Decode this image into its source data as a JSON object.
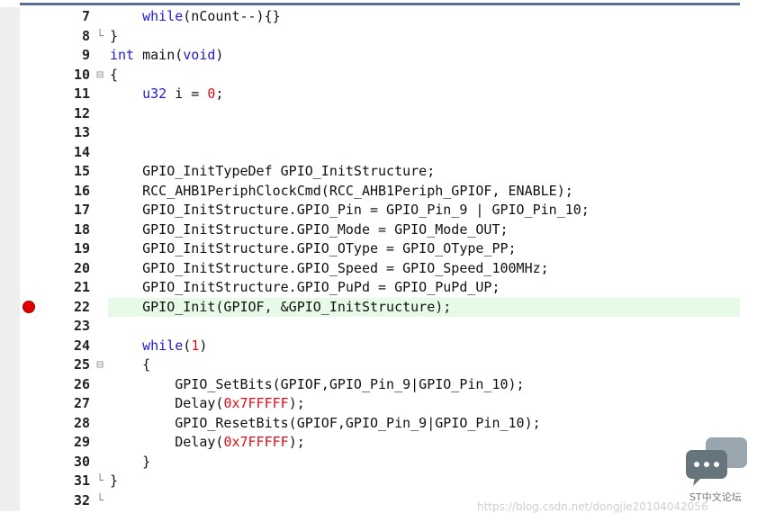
{
  "lines": [
    {
      "num": "7",
      "fold": "",
      "segments": [
        {
          "t": "    "
        },
        {
          "t": "while",
          "c": "kw"
        },
        {
          "t": "(nCount--){}"
        }
      ]
    },
    {
      "num": "8",
      "fold": "└",
      "segments": [
        {
          "t": "}"
        }
      ]
    },
    {
      "num": "9",
      "fold": "",
      "segments": [
        {
          "t": "int",
          "c": "kw"
        },
        {
          "t": " main("
        },
        {
          "t": "void",
          "c": "kw"
        },
        {
          "t": ")"
        }
      ]
    },
    {
      "num": "10",
      "fold": "⊟",
      "segments": [
        {
          "t": "{"
        }
      ]
    },
    {
      "num": "11",
      "fold": "",
      "segments": [
        {
          "t": "    "
        },
        {
          "t": "u32",
          "c": "kw"
        },
        {
          "t": " i = "
        },
        {
          "t": "0",
          "c": "num"
        },
        {
          "t": ";"
        }
      ]
    },
    {
      "num": "12",
      "fold": "",
      "segments": []
    },
    {
      "num": "13",
      "fold": "",
      "segments": []
    },
    {
      "num": "14",
      "fold": "",
      "segments": []
    },
    {
      "num": "15",
      "fold": "",
      "segments": [
        {
          "t": "    GPIO_InitTypeDef GPIO_InitStructure;"
        }
      ]
    },
    {
      "num": "16",
      "fold": "",
      "segments": [
        {
          "t": "    RCC_AHB1PeriphClockCmd(RCC_AHB1Periph_GPIOF, ENABLE);"
        }
      ]
    },
    {
      "num": "17",
      "fold": "",
      "segments": [
        {
          "t": "    GPIO_InitStructure.GPIO_Pin = GPIO_Pin_9 | GPIO_Pin_10;"
        }
      ]
    },
    {
      "num": "18",
      "fold": "",
      "segments": [
        {
          "t": "    GPIO_InitStructure.GPIO_Mode = GPIO_Mode_OUT;"
        }
      ]
    },
    {
      "num": "19",
      "fold": "",
      "segments": [
        {
          "t": "    GPIO_InitStructure.GPIO_OType = GPIO_OType_PP;"
        }
      ]
    },
    {
      "num": "20",
      "fold": "",
      "segments": [
        {
          "t": "    GPIO_InitStructure.GPIO_Speed = GPIO_Speed_100MHz;"
        }
      ]
    },
    {
      "num": "21",
      "fold": "",
      "segments": [
        {
          "t": "    GPIO_InitStructure.GPIO_PuPd = GPIO_PuPd_UP;"
        }
      ]
    },
    {
      "num": "22",
      "fold": "",
      "breakpoint": true,
      "highlight": true,
      "segments": [
        {
          "t": "    GPIO_Init(GPIOF, &GPIO_InitStructure);"
        }
      ]
    },
    {
      "num": "23",
      "fold": "",
      "segments": []
    },
    {
      "num": "24",
      "fold": "",
      "segments": [
        {
          "t": "    "
        },
        {
          "t": "while",
          "c": "kw"
        },
        {
          "t": "("
        },
        {
          "t": "1",
          "c": "num"
        },
        {
          "t": ")"
        }
      ]
    },
    {
      "num": "25",
      "fold": "⊟",
      "segments": [
        {
          "t": "    {"
        }
      ]
    },
    {
      "num": "26",
      "fold": "",
      "segments": [
        {
          "t": "        GPIO_SetBits(GPIOF,GPIO_Pin_9|GPIO_Pin_10);"
        }
      ]
    },
    {
      "num": "27",
      "fold": "",
      "segments": [
        {
          "t": "        Delay("
        },
        {
          "t": "0x7FFFFF",
          "c": "num"
        },
        {
          "t": ");"
        }
      ]
    },
    {
      "num": "28",
      "fold": "",
      "segments": [
        {
          "t": "        GPIO_ResetBits(GPIOF,GPIO_Pin_9|GPIO_Pin_10);"
        }
      ]
    },
    {
      "num": "29",
      "fold": "",
      "segments": [
        {
          "t": "        Delay("
        },
        {
          "t": "0x7FFFFF",
          "c": "num"
        },
        {
          "t": ");"
        }
      ]
    },
    {
      "num": "30",
      "fold": "",
      "segments": [
        {
          "t": "    }"
        }
      ]
    },
    {
      "num": "31",
      "fold": "└",
      "segments": [
        {
          "t": "}"
        }
      ]
    },
    {
      "num": "32",
      "fold": "└",
      "segments": []
    }
  ],
  "watermark": {
    "icon": "chat-bubble-icon",
    "label": "ST中文论坛",
    "url": "https://blog.csdn.net/dongjie20104042056"
  },
  "colors": {
    "keyword": "#1c1cd0",
    "number": "#e0101a",
    "highlight": "#e7f9e7",
    "breakpoint": "#e00000"
  }
}
